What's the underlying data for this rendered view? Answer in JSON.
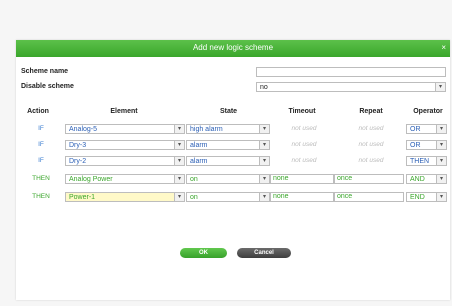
{
  "dialog": {
    "title": "Add new logic scheme",
    "close": "×"
  },
  "form": {
    "scheme_name_label": "Scheme name",
    "scheme_name_value": "",
    "disable_label": "Disable scheme",
    "disable_value": "no"
  },
  "table": {
    "headers": {
      "action": "Action",
      "element": "Element",
      "state": "State",
      "timeout": "Timeout",
      "repeat": "Repeat",
      "operator": "Operator"
    },
    "rows": [
      {
        "action": "IF",
        "element": "Analog-5",
        "state": "high alarm",
        "timeout": "not used",
        "repeat": "not used",
        "operator": "OR"
      },
      {
        "action": "IF",
        "element": "Dry-3",
        "state": "alarm",
        "timeout": "not used",
        "repeat": "not used",
        "operator": "OR"
      },
      {
        "action": "IF",
        "element": "Dry-2",
        "state": "alarm",
        "timeout": "not used",
        "repeat": "not used",
        "operator": "THEN"
      },
      {
        "action": "THEN",
        "element": "Analog Power",
        "state": "on",
        "timeout": "none",
        "repeat": "once",
        "operator": "AND"
      },
      {
        "action": "THEN",
        "element": "Power-1",
        "state": "on",
        "timeout": "none",
        "repeat": "once",
        "operator": "END"
      }
    ]
  },
  "buttons": {
    "ok": "OK",
    "cancel": "Cancel"
  },
  "colors": {
    "title_bar": "#3aa62b",
    "if_action": "#3c7fd0",
    "then_action": "#3aa62b",
    "highlight": "#fff9c8"
  },
  "icons": {
    "dropdown": "chevron-down-icon",
    "close": "close-icon"
  }
}
